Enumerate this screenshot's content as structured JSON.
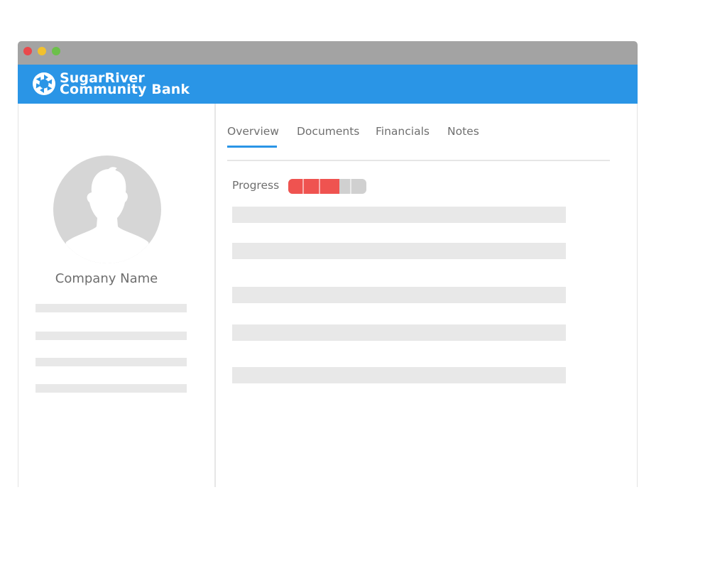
{
  "brand": {
    "line1": "SugarRiver",
    "line2": "Community Bank",
    "color": "#2a95e6"
  },
  "window_controls": {
    "close_color": "#e9494c",
    "minimize_color": "#f2c12e",
    "maximize_color": "#6cc04a"
  },
  "sidebar": {
    "company_name": "Company Name"
  },
  "tabs": [
    {
      "label": "Overview",
      "active": true
    },
    {
      "label": "Documents",
      "active": false
    },
    {
      "label": "Financials",
      "active": false
    },
    {
      "label": "Notes",
      "active": false
    }
  ],
  "progress": {
    "label": "Progress",
    "fraction": 0.65,
    "color": "#ef5350"
  },
  "accent_color": "#2a95e6"
}
